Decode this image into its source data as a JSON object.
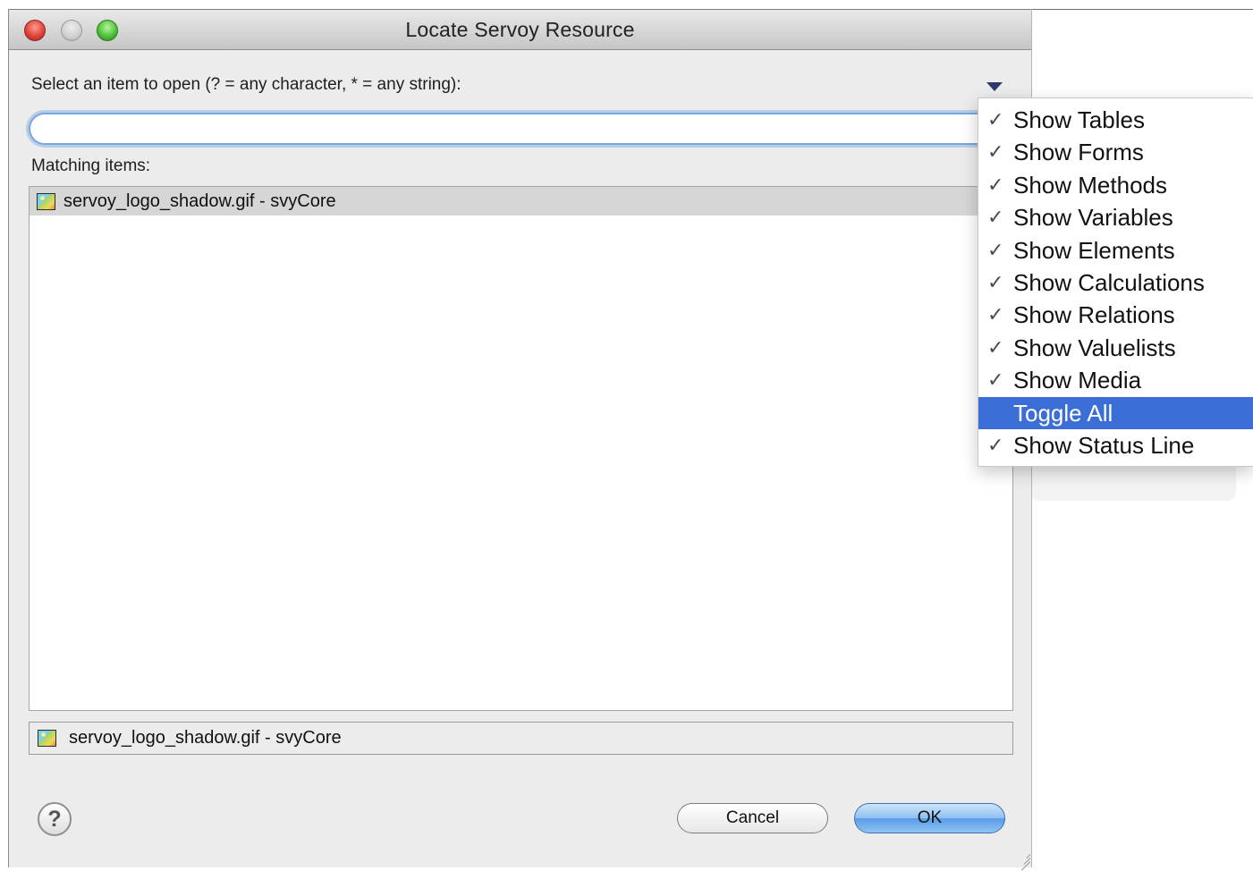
{
  "window": {
    "title": "Locate Servoy Resource"
  },
  "search": {
    "label": "Select an item to open (? = any character, * = any string):",
    "value": "",
    "placeholder": ""
  },
  "results": {
    "label": "Matching items:",
    "items": [
      {
        "icon": "image-file-icon",
        "text": "servoy_logo_shadow.gif - svyCore"
      }
    ]
  },
  "status_line": {
    "icon": "image-file-icon",
    "text": "servoy_logo_shadow.gif - svyCore"
  },
  "buttons": {
    "cancel": "Cancel",
    "ok": "OK"
  },
  "menu": {
    "items": [
      {
        "label": "Show Tables",
        "checked": true
      },
      {
        "label": "Show Forms",
        "checked": true
      },
      {
        "label": "Show Methods",
        "checked": true
      },
      {
        "label": "Show Variables",
        "checked": true
      },
      {
        "label": "Show Elements",
        "checked": true
      },
      {
        "label": "Show Calculations",
        "checked": true
      },
      {
        "label": "Show Relations",
        "checked": true
      },
      {
        "label": "Show Valuelists",
        "checked": true
      },
      {
        "label": "Show Media",
        "checked": true
      },
      {
        "label": "Toggle All",
        "checked": false,
        "highlighted": true
      },
      {
        "label": "Show Status Line",
        "checked": true
      }
    ]
  },
  "colors": {
    "highlight": "#3b6fd7",
    "focus_ring": "#7aa7dc",
    "ok_button": "#5a9ae6"
  }
}
